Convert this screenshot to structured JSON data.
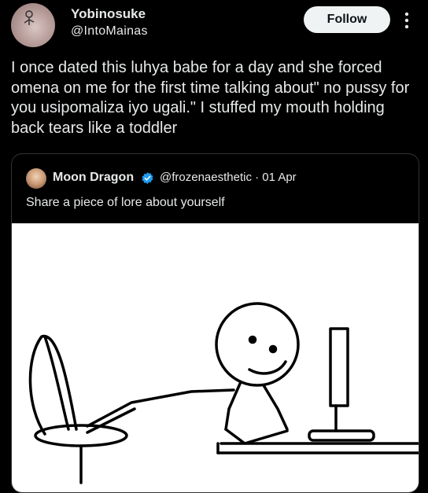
{
  "author": {
    "name": "Yobinosuke",
    "handle": "@IntoMainas"
  },
  "follow_label": "Follow",
  "tweet_text": "I once dated this luhya babe for a day and she forced omena on me for the first time talking about\" no pussy for you usipomaliza iyo ugali.\" I stuffed my mouth holding back tears like a toddler",
  "quote": {
    "name": "Moon Dragon",
    "handle": "@frozenaesthetic",
    "date": "01 Apr",
    "text": "Share a piece of lore about yourself"
  },
  "icons": {
    "more": "more-vertical-icon",
    "verified": "verified-badge-icon"
  },
  "colors": {
    "background": "#000000",
    "text": "#e7e9ea",
    "follow_bg": "#eff3f4",
    "verified": "#1d9bf0"
  }
}
